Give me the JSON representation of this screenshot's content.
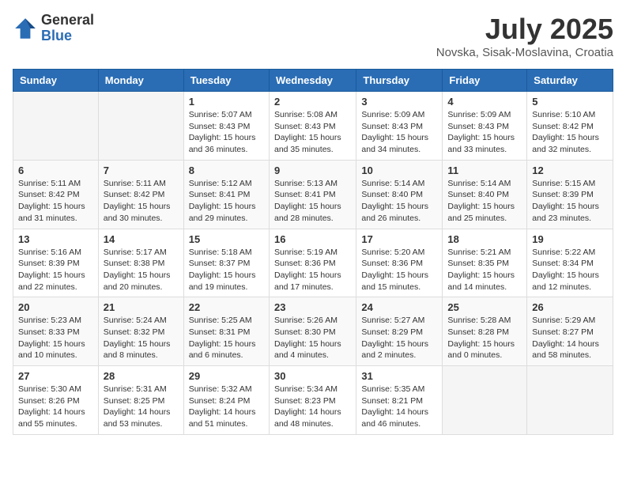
{
  "logo": {
    "general": "General",
    "blue": "Blue"
  },
  "title": "July 2025",
  "location": "Novska, Sisak-Moslavina, Croatia",
  "days_of_week": [
    "Sunday",
    "Monday",
    "Tuesday",
    "Wednesday",
    "Thursday",
    "Friday",
    "Saturday"
  ],
  "weeks": [
    [
      {
        "day": "",
        "sunrise": "",
        "sunset": "",
        "daylight": ""
      },
      {
        "day": "",
        "sunrise": "",
        "sunset": "",
        "daylight": ""
      },
      {
        "day": "1",
        "sunrise": "Sunrise: 5:07 AM",
        "sunset": "Sunset: 8:43 PM",
        "daylight": "Daylight: 15 hours and 36 minutes."
      },
      {
        "day": "2",
        "sunrise": "Sunrise: 5:08 AM",
        "sunset": "Sunset: 8:43 PM",
        "daylight": "Daylight: 15 hours and 35 minutes."
      },
      {
        "day": "3",
        "sunrise": "Sunrise: 5:09 AM",
        "sunset": "Sunset: 8:43 PM",
        "daylight": "Daylight: 15 hours and 34 minutes."
      },
      {
        "day": "4",
        "sunrise": "Sunrise: 5:09 AM",
        "sunset": "Sunset: 8:43 PM",
        "daylight": "Daylight: 15 hours and 33 minutes."
      },
      {
        "day": "5",
        "sunrise": "Sunrise: 5:10 AM",
        "sunset": "Sunset: 8:42 PM",
        "daylight": "Daylight: 15 hours and 32 minutes."
      }
    ],
    [
      {
        "day": "6",
        "sunrise": "Sunrise: 5:11 AM",
        "sunset": "Sunset: 8:42 PM",
        "daylight": "Daylight: 15 hours and 31 minutes."
      },
      {
        "day": "7",
        "sunrise": "Sunrise: 5:11 AM",
        "sunset": "Sunset: 8:42 PM",
        "daylight": "Daylight: 15 hours and 30 minutes."
      },
      {
        "day": "8",
        "sunrise": "Sunrise: 5:12 AM",
        "sunset": "Sunset: 8:41 PM",
        "daylight": "Daylight: 15 hours and 29 minutes."
      },
      {
        "day": "9",
        "sunrise": "Sunrise: 5:13 AM",
        "sunset": "Sunset: 8:41 PM",
        "daylight": "Daylight: 15 hours and 28 minutes."
      },
      {
        "day": "10",
        "sunrise": "Sunrise: 5:14 AM",
        "sunset": "Sunset: 8:40 PM",
        "daylight": "Daylight: 15 hours and 26 minutes."
      },
      {
        "day": "11",
        "sunrise": "Sunrise: 5:14 AM",
        "sunset": "Sunset: 8:40 PM",
        "daylight": "Daylight: 15 hours and 25 minutes."
      },
      {
        "day": "12",
        "sunrise": "Sunrise: 5:15 AM",
        "sunset": "Sunset: 8:39 PM",
        "daylight": "Daylight: 15 hours and 23 minutes."
      }
    ],
    [
      {
        "day": "13",
        "sunrise": "Sunrise: 5:16 AM",
        "sunset": "Sunset: 8:39 PM",
        "daylight": "Daylight: 15 hours and 22 minutes."
      },
      {
        "day": "14",
        "sunrise": "Sunrise: 5:17 AM",
        "sunset": "Sunset: 8:38 PM",
        "daylight": "Daylight: 15 hours and 20 minutes."
      },
      {
        "day": "15",
        "sunrise": "Sunrise: 5:18 AM",
        "sunset": "Sunset: 8:37 PM",
        "daylight": "Daylight: 15 hours and 19 minutes."
      },
      {
        "day": "16",
        "sunrise": "Sunrise: 5:19 AM",
        "sunset": "Sunset: 8:36 PM",
        "daylight": "Daylight: 15 hours and 17 minutes."
      },
      {
        "day": "17",
        "sunrise": "Sunrise: 5:20 AM",
        "sunset": "Sunset: 8:36 PM",
        "daylight": "Daylight: 15 hours and 15 minutes."
      },
      {
        "day": "18",
        "sunrise": "Sunrise: 5:21 AM",
        "sunset": "Sunset: 8:35 PM",
        "daylight": "Daylight: 15 hours and 14 minutes."
      },
      {
        "day": "19",
        "sunrise": "Sunrise: 5:22 AM",
        "sunset": "Sunset: 8:34 PM",
        "daylight": "Daylight: 15 hours and 12 minutes."
      }
    ],
    [
      {
        "day": "20",
        "sunrise": "Sunrise: 5:23 AM",
        "sunset": "Sunset: 8:33 PM",
        "daylight": "Daylight: 15 hours and 10 minutes."
      },
      {
        "day": "21",
        "sunrise": "Sunrise: 5:24 AM",
        "sunset": "Sunset: 8:32 PM",
        "daylight": "Daylight: 15 hours and 8 minutes."
      },
      {
        "day": "22",
        "sunrise": "Sunrise: 5:25 AM",
        "sunset": "Sunset: 8:31 PM",
        "daylight": "Daylight: 15 hours and 6 minutes."
      },
      {
        "day": "23",
        "sunrise": "Sunrise: 5:26 AM",
        "sunset": "Sunset: 8:30 PM",
        "daylight": "Daylight: 15 hours and 4 minutes."
      },
      {
        "day": "24",
        "sunrise": "Sunrise: 5:27 AM",
        "sunset": "Sunset: 8:29 PM",
        "daylight": "Daylight: 15 hours and 2 minutes."
      },
      {
        "day": "25",
        "sunrise": "Sunrise: 5:28 AM",
        "sunset": "Sunset: 8:28 PM",
        "daylight": "Daylight: 15 hours and 0 minutes."
      },
      {
        "day": "26",
        "sunrise": "Sunrise: 5:29 AM",
        "sunset": "Sunset: 8:27 PM",
        "daylight": "Daylight: 14 hours and 58 minutes."
      }
    ],
    [
      {
        "day": "27",
        "sunrise": "Sunrise: 5:30 AM",
        "sunset": "Sunset: 8:26 PM",
        "daylight": "Daylight: 14 hours and 55 minutes."
      },
      {
        "day": "28",
        "sunrise": "Sunrise: 5:31 AM",
        "sunset": "Sunset: 8:25 PM",
        "daylight": "Daylight: 14 hours and 53 minutes."
      },
      {
        "day": "29",
        "sunrise": "Sunrise: 5:32 AM",
        "sunset": "Sunset: 8:24 PM",
        "daylight": "Daylight: 14 hours and 51 minutes."
      },
      {
        "day": "30",
        "sunrise": "Sunrise: 5:34 AM",
        "sunset": "Sunset: 8:23 PM",
        "daylight": "Daylight: 14 hours and 48 minutes."
      },
      {
        "day": "31",
        "sunrise": "Sunrise: 5:35 AM",
        "sunset": "Sunset: 8:21 PM",
        "daylight": "Daylight: 14 hours and 46 minutes."
      },
      {
        "day": "",
        "sunrise": "",
        "sunset": "",
        "daylight": ""
      },
      {
        "day": "",
        "sunrise": "",
        "sunset": "",
        "daylight": ""
      }
    ]
  ]
}
